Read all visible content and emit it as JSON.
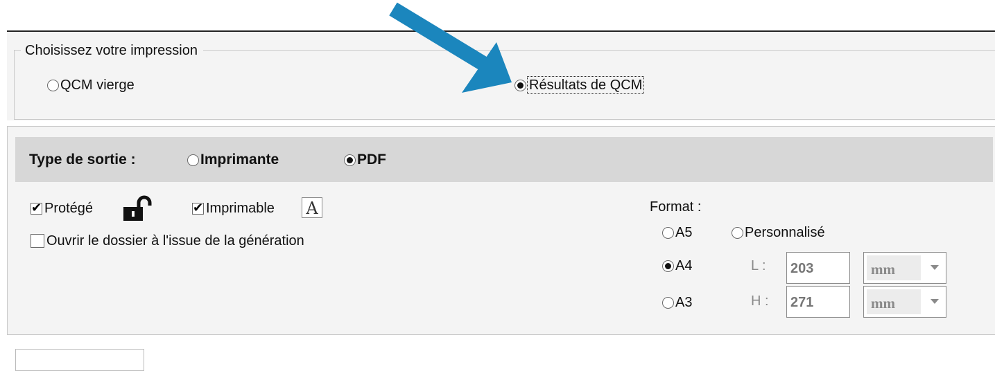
{
  "choice": {
    "legend": "Choisissez votre impression",
    "options": [
      {
        "label": "QCM vierge",
        "selected": false
      },
      {
        "label": "Résultats de QCM",
        "selected": true
      }
    ]
  },
  "output": {
    "type_label": "Type de sortie :",
    "types": [
      {
        "label": "Imprimante",
        "selected": false
      },
      {
        "label": "PDF",
        "selected": true
      }
    ],
    "protected_label": "Protégé",
    "protected_checked": true,
    "printable_label": "Imprimable",
    "printable_checked": true,
    "open_folder_label": "Ouvrir le dossier à l'issue de la génération",
    "open_folder_checked": false,
    "format_label": "Format :",
    "formats": [
      {
        "label": "A5",
        "selected": false
      },
      {
        "label": "Personnalisé",
        "selected": false
      },
      {
        "label": "A4",
        "selected": true
      },
      {
        "label": "A3",
        "selected": false
      }
    ],
    "width_label": "L :",
    "height_label": "H :",
    "width_value": "203",
    "height_value": "271",
    "width_unit": "mm",
    "height_unit": "mm",
    "printable_icon_letter": "A"
  },
  "icons": {
    "lock": "unlocked-padlock-icon",
    "arrow": "annotation-arrow-icon"
  },
  "colors": {
    "arrow": "#1b86bd",
    "header_bar": "#d7d7d7"
  }
}
